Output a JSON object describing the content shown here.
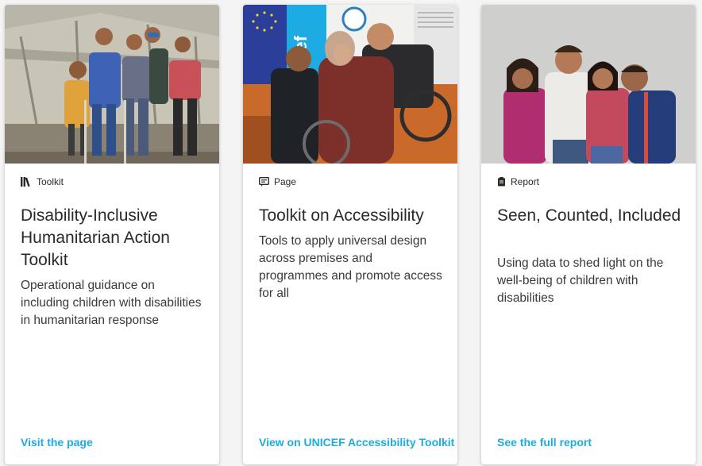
{
  "cards": [
    {
      "type_label": "Toolkit",
      "type_icon": "books-icon",
      "title": "Disability-Inclusive Humanitarian Action Toolkit",
      "description": "Operational guidance on including children with disabilities in humanitarian response",
      "link_label": "Visit the page",
      "image": "photo of children standing in front of a tent"
    },
    {
      "type_label": "Page",
      "type_icon": "page-icon",
      "title": "Toolkit on Accessibility",
      "description": "Tools to apply universal design across premises and programmes and promote access for all",
      "link_label": "View on UNICEF Accessibility Toolkit",
      "image": "photo of a woman in a wheelchair with a boy and a man",
      "image_text": "cef"
    },
    {
      "type_label": "Report",
      "type_icon": "report-icon",
      "title": "Seen, Counted, Included",
      "description": "Using data to shed light on the well-being of children with disabilities",
      "link_label": "See the full report",
      "image": "photo of four smiling children hugging"
    }
  ],
  "colors": {
    "link": "#1cabe2",
    "title": "#2d2926",
    "card_bg": "#ffffff",
    "page_bg": "#f4f4f4"
  }
}
